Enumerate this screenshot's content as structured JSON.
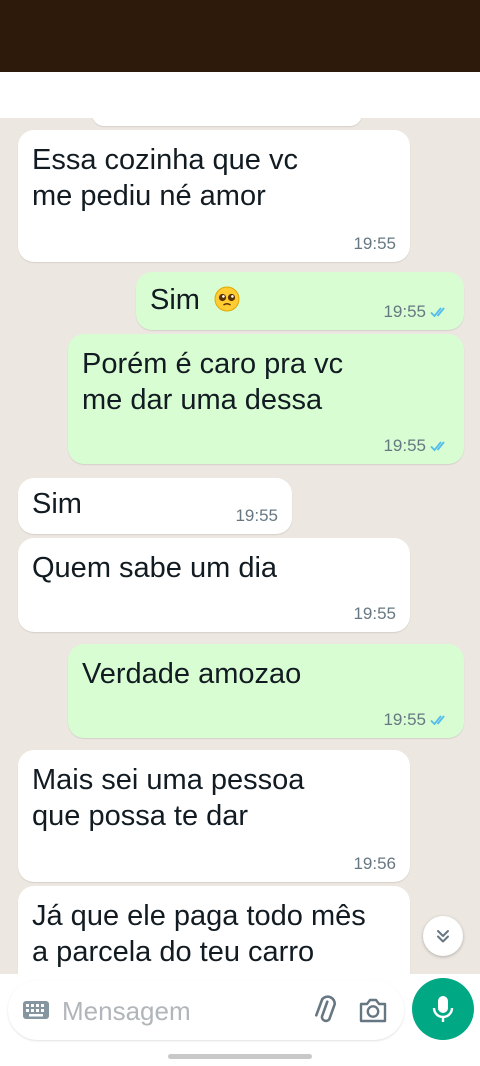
{
  "colors": {
    "top_band": "#2e1a0b",
    "chat_background": "#ece7e0",
    "incoming_bubble": "#ffffff",
    "outgoing_bubble": "#d9fdd3",
    "read_ticks": "#53bdeb",
    "accent": "#00a884"
  },
  "messages": [
    {
      "direction": "incoming",
      "lines": [
        "Essa cozinha que vc",
        "me pediu né amor"
      ],
      "time": "19:55"
    },
    {
      "direction": "outgoing",
      "lines": [
        "Sim"
      ],
      "emoji": "pleading-face-emoji",
      "time": "19:55",
      "status": "read"
    },
    {
      "direction": "outgoing",
      "lines": [
        "Porém é caro pra vc",
        "me dar uma dessa"
      ],
      "time": "19:55",
      "status": "read"
    },
    {
      "direction": "incoming",
      "lines": [
        "Sim"
      ],
      "time": "19:55"
    },
    {
      "direction": "incoming",
      "lines": [
        "Quem sabe um dia"
      ],
      "time": "19:55"
    },
    {
      "direction": "outgoing",
      "lines": [
        "Verdade amozao"
      ],
      "time": "19:55",
      "status": "read"
    },
    {
      "direction": "incoming",
      "lines": [
        "Mais sei uma pessoa",
        "que possa te dar"
      ],
      "time": "19:56"
    },
    {
      "direction": "incoming",
      "lines": [
        "Já que ele paga todo mês",
        "a parcela do teu carro"
      ],
      "time": ""
    }
  ],
  "composer": {
    "placeholder": "Mensagem",
    "value": ""
  },
  "icons": {
    "keyboard": "keyboard-icon",
    "attach": "paperclip-icon",
    "camera": "camera-icon",
    "mic": "microphone-icon",
    "scroll_down": "double-chevron-down-icon",
    "read_receipt": "double-check-icon"
  }
}
